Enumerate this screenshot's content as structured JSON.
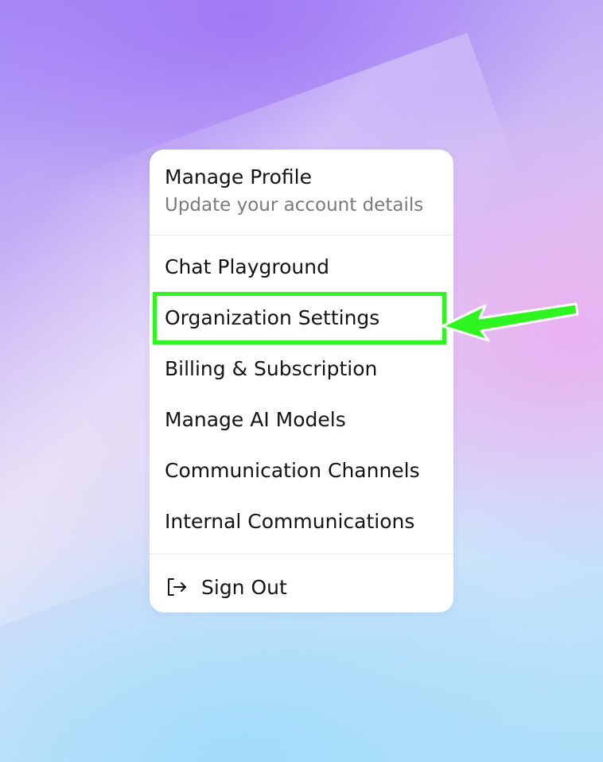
{
  "menu": {
    "profile": {
      "title": "Manage Profile",
      "subtitle": "Update your account details"
    },
    "items": [
      {
        "label": "Chat Playground"
      },
      {
        "label": "Organization Settings"
      },
      {
        "label": "Billing & Subscription"
      },
      {
        "label": "Manage AI Models"
      },
      {
        "label": "Communication Channels"
      },
      {
        "label": "Internal Communications"
      }
    ],
    "sign_out": {
      "label": "Sign Out",
      "icon": "sign-out-icon"
    }
  },
  "annotation": {
    "highlighted_item": "Organization Settings",
    "color": "#2ef51f"
  }
}
